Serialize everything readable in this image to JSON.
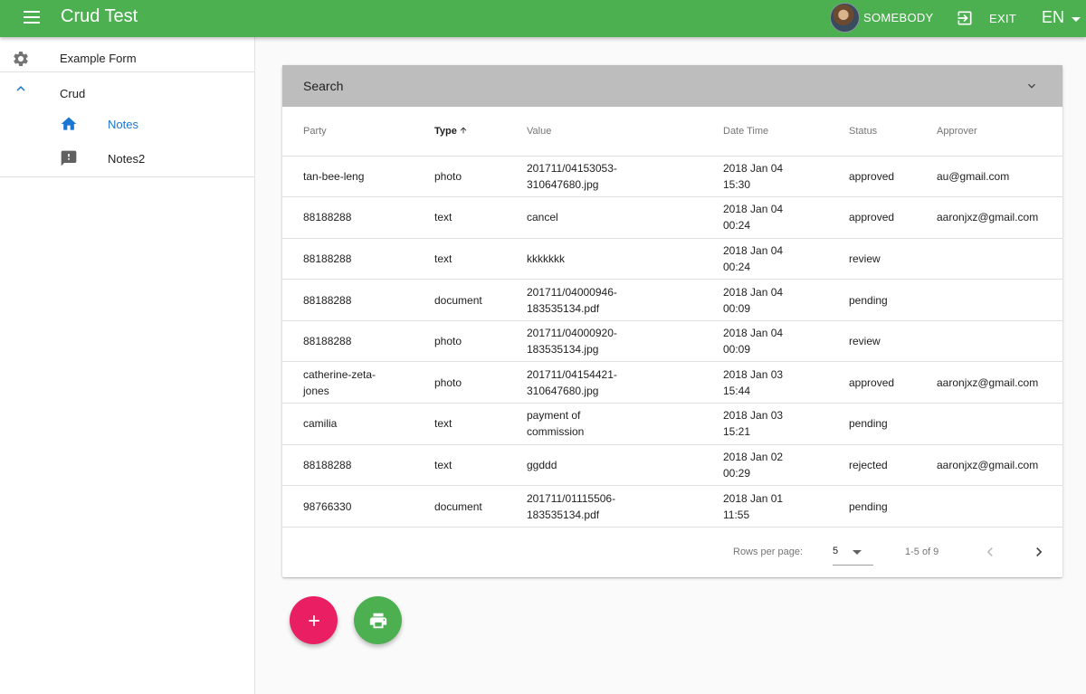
{
  "app": {
    "title": "Crud Test"
  },
  "header": {
    "user_name": "SOMEBODY",
    "exit_label": "EXIT",
    "language": "EN"
  },
  "sidebar": {
    "items": [
      {
        "label": "Example Form",
        "icon": "gear-icon"
      },
      {
        "label": "Crud",
        "icon": "chevron-up-icon"
      },
      {
        "label": "Notes",
        "icon": "home-icon",
        "active": true
      },
      {
        "label": "Notes2",
        "icon": "feedback-icon"
      }
    ]
  },
  "search": {
    "label": "Search"
  },
  "table": {
    "columns": [
      "Party",
      "Type",
      "Value",
      "Date Time",
      "Status",
      "Approver"
    ],
    "sorted_column": "Type",
    "rows": [
      {
        "party": "tan-bee-leng",
        "type": "photo",
        "value": "201711/04153053-310647680.jpg",
        "datetime": "2018 Jan 04 15:30",
        "status": "approved",
        "approver": "au@gmail.com"
      },
      {
        "party": "88188288",
        "type": "text",
        "value": "cancel",
        "datetime": "2018 Jan 04 00:24",
        "status": "approved",
        "approver": "aaronjxz@gmail.com"
      },
      {
        "party": "88188288",
        "type": "text",
        "value": "kkkkkkk",
        "datetime": "2018 Jan 04 00:24",
        "status": "review",
        "approver": ""
      },
      {
        "party": "88188288",
        "type": "document",
        "value": "201711/04000946-183535134.pdf",
        "datetime": "2018 Jan 04 00:09",
        "status": "pending",
        "approver": ""
      },
      {
        "party": "88188288",
        "type": "photo",
        "value": "201711/04000920-183535134.jpg",
        "datetime": "2018 Jan 04 00:09",
        "status": "review",
        "approver": ""
      },
      {
        "party": "catherine-zeta-jones",
        "type": "photo",
        "value": "201711/04154421-310647680.jpg",
        "datetime": "2018 Jan 03 15:44",
        "status": "approved",
        "approver": "aaronjxz@gmail.com"
      },
      {
        "party": "camilia",
        "type": "text",
        "value": "payment of commission",
        "datetime": "2018 Jan 03 15:21",
        "status": "pending",
        "approver": ""
      },
      {
        "party": "88188288",
        "type": "text",
        "value": "ggddd",
        "datetime": "2018 Jan 02 00:29",
        "status": "rejected",
        "approver": "aaronjxz@gmail.com"
      },
      {
        "party": "98766330",
        "type": "document",
        "value": "201711/01115506-183535134.pdf",
        "datetime": "2018 Jan 01 11:55",
        "status": "pending",
        "approver": ""
      }
    ]
  },
  "pagination": {
    "rows_per_page_label": "Rows per page:",
    "rows_per_page": "5",
    "range": "1-5 of 9"
  },
  "colors": {
    "primary": "#4caf50",
    "accent": "#e91e63",
    "active_nav": "#1976d2",
    "search_bar": "#bdbdbd"
  }
}
